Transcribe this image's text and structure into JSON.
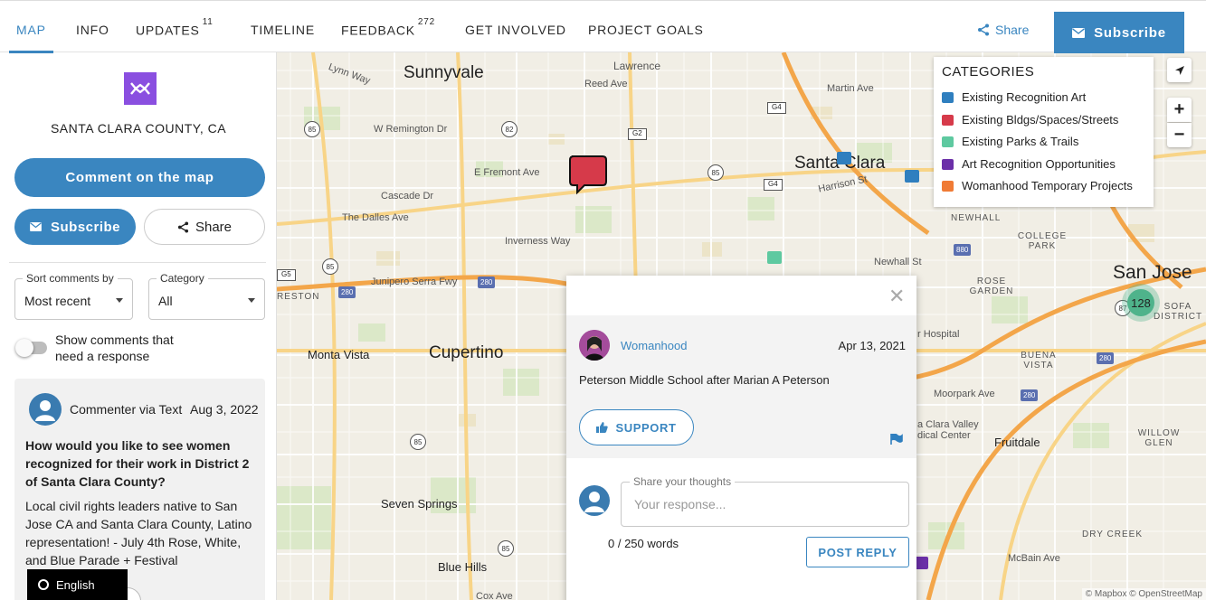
{
  "nav": {
    "tabs": [
      {
        "label": "MAP",
        "badge": ""
      },
      {
        "label": "INFO",
        "badge": ""
      },
      {
        "label": "UPDATES",
        "badge": "11"
      },
      {
        "label": "TIMELINE",
        "badge": ""
      },
      {
        "label": "FEEDBACK",
        "badge": "272"
      },
      {
        "label": "GET INVOLVED",
        "badge": ""
      },
      {
        "label": "PROJECT GOALS",
        "badge": ""
      }
    ],
    "share_label": "Share",
    "subscribe_label": "Subscribe"
  },
  "sidebar": {
    "county": "SANTA CLARA COUNTY, CA",
    "comment_button": "Comment on the map",
    "subscribe_button": "Subscribe",
    "share_button": "Share",
    "sort": {
      "legend": "Sort comments by",
      "value": "Most recent"
    },
    "category": {
      "legend": "Category",
      "value": "All"
    },
    "toggle_label": "Show comments that need a response",
    "card": {
      "author": "Commenter via Text",
      "date": "Aug 3, 2022",
      "question": "How would you like to see women recognized for their work in District 2 of Santa Clara County?",
      "body": "Local civil rights leaders native to San Jose CA and Santa Clara County, Latino representation! - July 4th Rose, White, and Blue Parade + Festival"
    },
    "language": "English"
  },
  "map": {
    "cities": {
      "sunnyvale": "Sunnyvale",
      "cupertino": "Cupertino",
      "santa_clara": "Santa Clara",
      "san_jose": "San Jose",
      "monta_vista": "Monta Vista",
      "seven_springs": "Seven Springs",
      "blue_hills": "Blue Hills",
      "fruitdale": "Fruitdale"
    },
    "streets": {
      "lawrence": "Lawrence",
      "reed_ave": "Reed Ave",
      "martin_ave": "Martin Ave",
      "remington": "W Remington Dr",
      "fremont": "E Fremont Ave",
      "cascade": "Cascade Dr",
      "dalles": "The Dalles Ave",
      "inverness": "Inverness Way",
      "junipero": "Junipero Serra Fwy",
      "newhall": "Newhall St",
      "rose_garden": "ROSE GARDEN",
      "buena_vista": "BUENA VISTA",
      "moorpark": "Moorpark Ave",
      "willow_glen": "WILLOW GLEN",
      "dry_creek": "DRY CREEK",
      "mcbain": "McBain Ave",
      "cox": "Cox Ave",
      "college_park": "COLLEGE PARK",
      "newhall_area": "NEWHALL",
      "sofa": "SOFA DISTRICT",
      "reston": "RESTON",
      "hospital": "r Hospital",
      "valley_med": "a Clara Valley dical Center",
      "lynn_way": "Lynn Way",
      "harrison": "Harrison St"
    },
    "shields": [
      "85",
      "82",
      "G2",
      "G4",
      "85",
      "85",
      "85",
      "280",
      "280",
      "280",
      "85",
      "87",
      "G5",
      "G4",
      "880",
      "280"
    ],
    "cluster_count": "128",
    "attribution": "© Mapbox © OpenStreetMap"
  },
  "categories": {
    "title": "CATEGORIES",
    "items": [
      {
        "label": "Existing Recognition Art",
        "color": "#2f7fbf"
      },
      {
        "label": "Existing Bldgs/Spaces/Streets",
        "color": "#d63a4a"
      },
      {
        "label": "Existing Parks & Trails",
        "color": "#5ec9a0"
      },
      {
        "label": "Art Recognition Opportunities",
        "color": "#6b2fa8"
      },
      {
        "label": "Womanhood Temporary Projects",
        "color": "#f07b35"
      }
    ]
  },
  "popup": {
    "author": "Womanhood",
    "date": "Apr 13, 2021",
    "text": "Peterson Middle School after Marian A Peterson",
    "support_label": "SUPPORT",
    "reply_legend": "Share your thoughts",
    "reply_placeholder": "Your response...",
    "word_count": "0 / 250 words",
    "post_label": "POST REPLY"
  },
  "colors": {
    "accent": "#3a86c0",
    "logo": "#8a4fe0"
  }
}
